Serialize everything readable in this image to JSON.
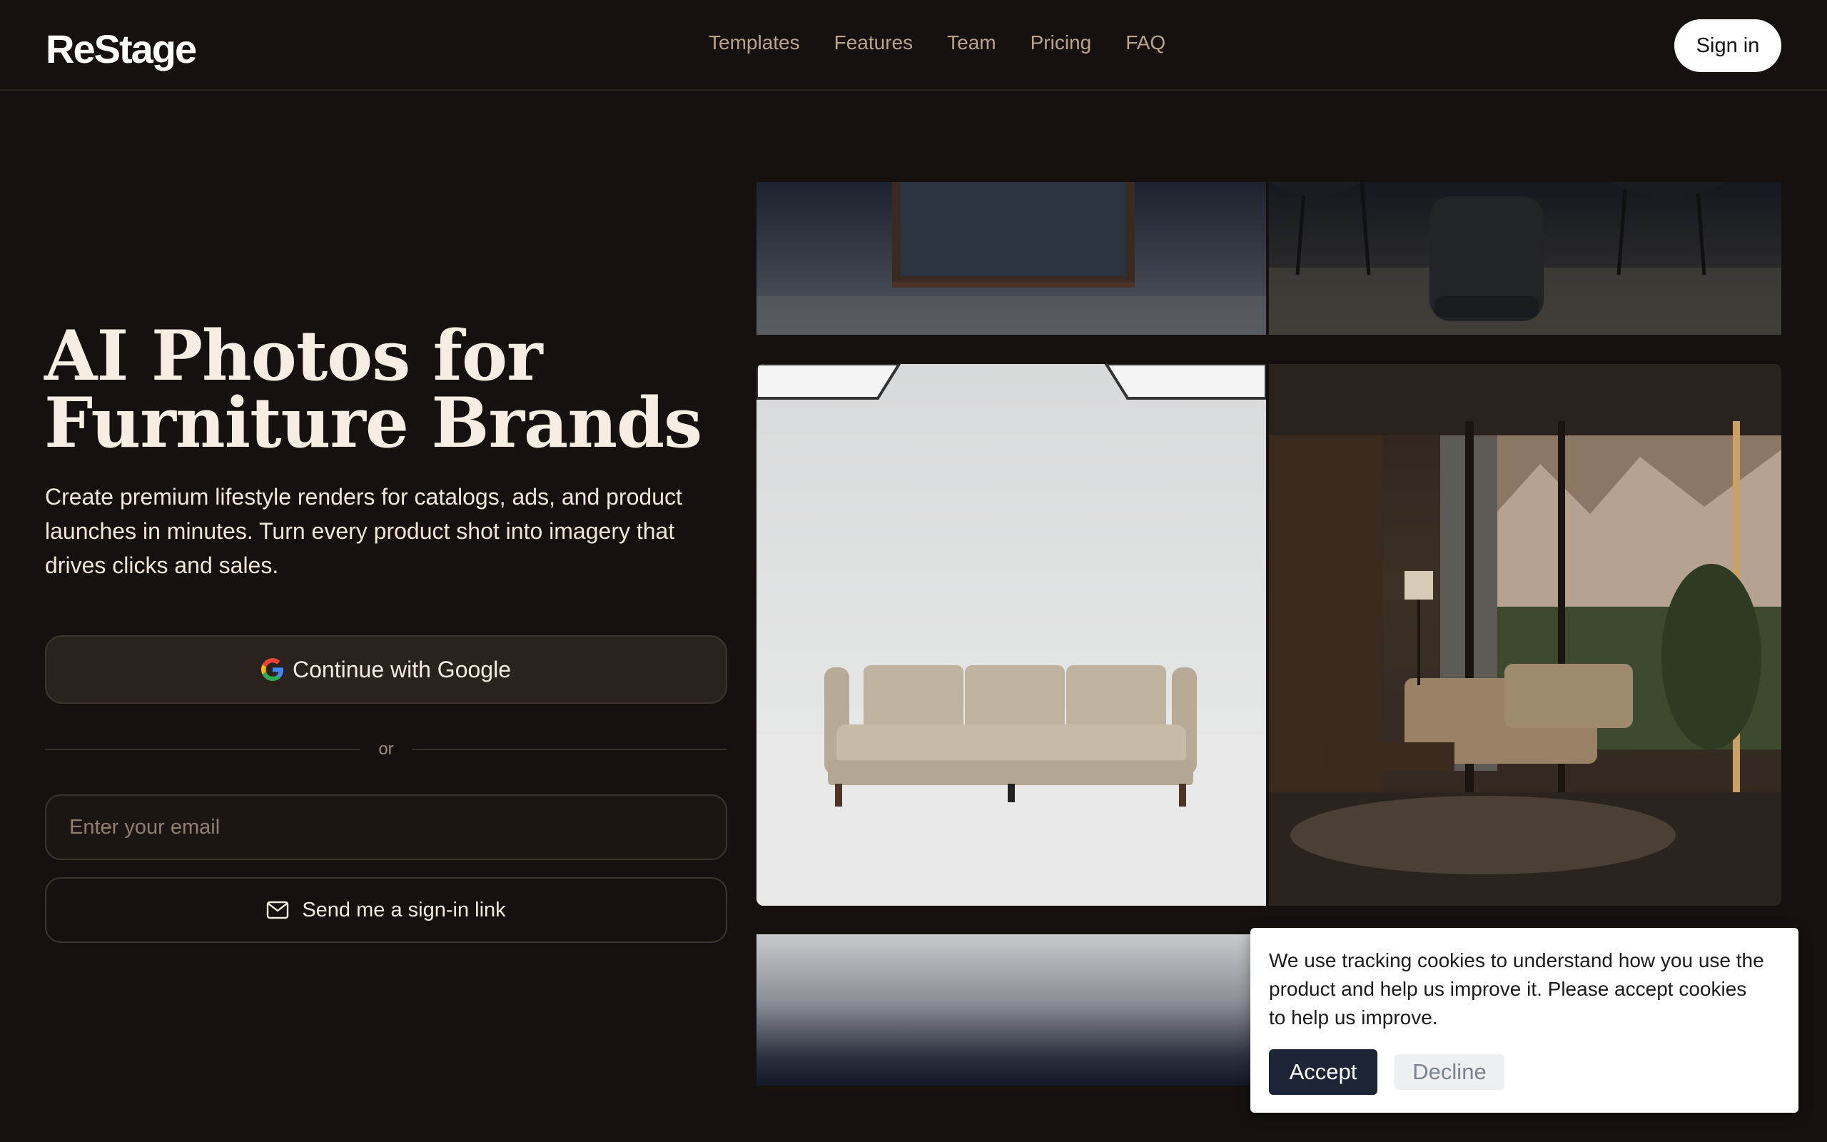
{
  "header": {
    "logo": "ReStage",
    "nav": [
      "Templates",
      "Features",
      "Team",
      "Pricing",
      "FAQ"
    ],
    "signin_label": "Sign in"
  },
  "hero": {
    "title_line1": "AI Photos for",
    "title_line2": "Furniture Brands",
    "subtitle": "Create premium lifestyle renders for catalogs, ads, and product launches in minutes. Turn every product shot into imagery that drives clicks and sales."
  },
  "auth": {
    "google_label": "Continue with Google",
    "divider_label": "or",
    "email_placeholder": "Enter your email",
    "email_value": "",
    "link_label": "Send me a sign-in link"
  },
  "cookie": {
    "text": "We use tracking cookies to understand how you use the product and help us improve it. Please accept cookies to help us improve.",
    "accept_label": "Accept",
    "decline_label": "Decline"
  },
  "colors": {
    "background": "#16110e",
    "accent_dark": "#1c2536",
    "nav_text": "#b8a48e"
  }
}
